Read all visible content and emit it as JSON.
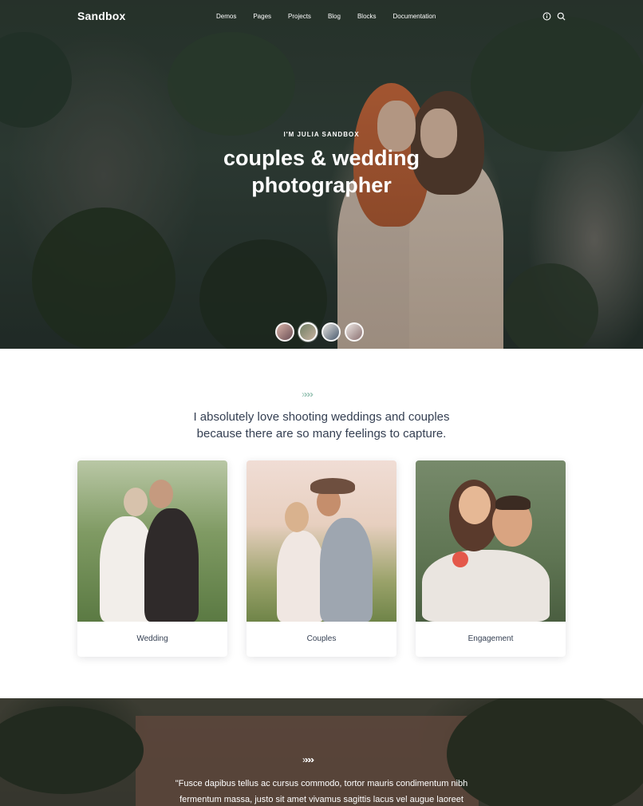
{
  "brand": {
    "logo": "Sandbox"
  },
  "nav": {
    "items": [
      {
        "label": "Demos"
      },
      {
        "label": "Pages"
      },
      {
        "label": "Projects"
      },
      {
        "label": "Blog"
      },
      {
        "label": "Blocks"
      },
      {
        "label": "Documentation"
      }
    ],
    "icons": [
      "info-icon",
      "search-icon"
    ]
  },
  "hero": {
    "eyebrow": "I'M JULIA SANDBOX",
    "title_line1": "couples & wedding",
    "title_line2": "photographer",
    "thumbnails": 4,
    "active_thumbnail": 2
  },
  "intro": {
    "text_line1": "I absolutely love shooting weddings and couples",
    "text_line2": "because there are so many feelings to capture."
  },
  "services": [
    {
      "label": "Wedding"
    },
    {
      "label": "Couples"
    },
    {
      "label": "Engagement"
    }
  ],
  "testimonial": {
    "line1": "\"Fusce dapibus tellus ac cursus commodo, tortor mauris condimentum nibh",
    "line2": "fermentum massa, justo sit amet vivamus sagittis lacus vel augue laoreet"
  },
  "colors": {
    "accent": "#9dc6b8",
    "text": "#343f52"
  }
}
